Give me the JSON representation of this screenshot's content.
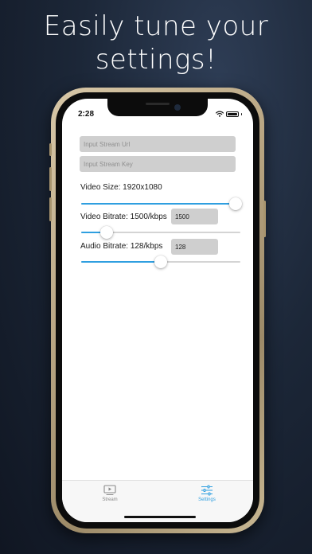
{
  "headline": {
    "line1": "Easily tune your",
    "line2": "settings!"
  },
  "status_bar": {
    "time": "2:28"
  },
  "settings": {
    "stream_url": {
      "placeholder": "Input Stream Url",
      "value": ""
    },
    "stream_key": {
      "placeholder": "Input Stream Key",
      "value": ""
    },
    "video_size": {
      "label": "Video Size: 1920x1080",
      "slider_fraction": 0.97
    },
    "video_bitrate": {
      "label": "Video Bitrate: 1500/kbps",
      "value": "1500",
      "slider_fraction": 0.16
    },
    "audio_bitrate": {
      "label": "Audio Bitrate: 128/kbps",
      "value": "128",
      "slider_fraction": 0.5
    }
  },
  "tabs": [
    {
      "label": "Stream",
      "icon": "play-screen-icon",
      "active": false
    },
    {
      "label": "Settings",
      "icon": "sliders-icon",
      "active": true
    }
  ],
  "colors": {
    "accent": "#2f9fe0",
    "inactive": "#8a8a8a",
    "field_bg": "#cfcfcf"
  }
}
